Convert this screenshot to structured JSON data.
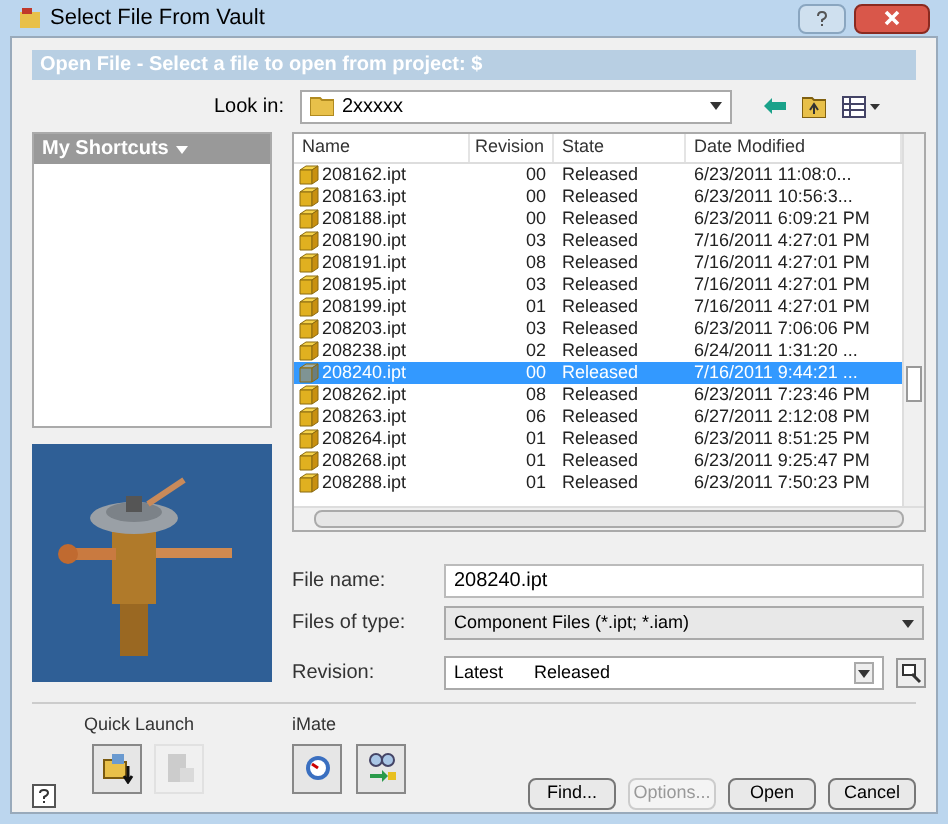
{
  "window": {
    "title": "Select File From Vault"
  },
  "header": "Open File - Select a file to open from project: $",
  "look_in": {
    "label": "Look in:",
    "value": "2xxxxx"
  },
  "shortcuts": {
    "title": "My Shortcuts"
  },
  "table": {
    "columns": [
      "Name",
      "Revision",
      "State",
      "Date Modified"
    ],
    "rows": [
      {
        "name": "208162.ipt",
        "revision": "00",
        "state": "Released",
        "date": "6/23/2011 11:08:0...",
        "selected": false
      },
      {
        "name": "208163.ipt",
        "revision": "00",
        "state": "Released",
        "date": "6/23/2011 10:56:3...",
        "selected": false
      },
      {
        "name": "208188.ipt",
        "revision": "00",
        "state": "Released",
        "date": "6/23/2011 6:09:21 PM",
        "selected": false
      },
      {
        "name": "208190.ipt",
        "revision": "03",
        "state": "Released",
        "date": "7/16/2011 4:27:01 PM",
        "selected": false
      },
      {
        "name": "208191.ipt",
        "revision": "08",
        "state": "Released",
        "date": "7/16/2011 4:27:01 PM",
        "selected": false
      },
      {
        "name": "208195.ipt",
        "revision": "03",
        "state": "Released",
        "date": "7/16/2011 4:27:01 PM",
        "selected": false
      },
      {
        "name": "208199.ipt",
        "revision": "01",
        "state": "Released",
        "date": "7/16/2011 4:27:01 PM",
        "selected": false
      },
      {
        "name": "208203.ipt",
        "revision": "03",
        "state": "Released",
        "date": "6/23/2011 7:06:06 PM",
        "selected": false
      },
      {
        "name": "208238.ipt",
        "revision": "02",
        "state": "Released",
        "date": "6/24/2011 1:31:20 ...",
        "selected": false
      },
      {
        "name": "208240.ipt",
        "revision": "00",
        "state": "Released",
        "date": "7/16/2011 9:44:21 ...",
        "selected": true
      },
      {
        "name": "208262.ipt",
        "revision": "08",
        "state": "Released",
        "date": "6/23/2011 7:23:46 PM",
        "selected": false
      },
      {
        "name": "208263.ipt",
        "revision": "06",
        "state": "Released",
        "date": "6/27/2011 2:12:08 PM",
        "selected": false
      },
      {
        "name": "208264.ipt",
        "revision": "01",
        "state": "Released",
        "date": "6/23/2011 8:51:25 PM",
        "selected": false
      },
      {
        "name": "208268.ipt",
        "revision": "01",
        "state": "Released",
        "date": "6/23/2011 9:25:47 PM",
        "selected": false
      },
      {
        "name": "208288.ipt",
        "revision": "01",
        "state": "Released",
        "date": "6/23/2011 7:50:23 PM",
        "selected": false
      }
    ]
  },
  "file_name": {
    "label": "File name:",
    "value": "208240.ipt"
  },
  "files_of_type": {
    "label": "Files of type:",
    "value": "Component Files (*.ipt; *.iam)"
  },
  "revision": {
    "label": "Revision:",
    "value": "Latest",
    "state": "Released"
  },
  "quick_launch": {
    "title": "Quick Launch",
    "buttons": [
      {
        "disabled": false
      },
      {
        "disabled": true
      }
    ]
  },
  "imate": {
    "title": "iMate"
  },
  "buttons": [
    {
      "label": "Find...",
      "disabled": false
    },
    {
      "label": "Options...",
      "disabled": true
    },
    {
      "label": "Open",
      "disabled": false
    },
    {
      "label": "Cancel",
      "disabled": false
    }
  ]
}
